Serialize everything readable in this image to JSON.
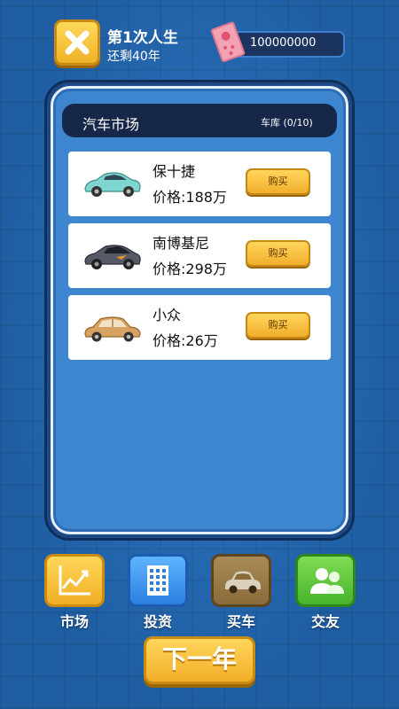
{
  "header": {
    "life_title": "第1次人生",
    "years_left": "还剩40年",
    "money": "100000000"
  },
  "market": {
    "title": "汽车市场",
    "garage": "车库 (0/10)",
    "cars": [
      {
        "name": "保十捷",
        "price": "价格:188万",
        "buy_label": "购买",
        "color": "#7fd6d1"
      },
      {
        "name": "南博基尼",
        "price": "价格:298万",
        "buy_label": "购买",
        "color": "#555a66"
      },
      {
        "name": "小众",
        "price": "价格:26万",
        "buy_label": "购买",
        "color": "#d8a262"
      }
    ]
  },
  "nav": {
    "market": "市场",
    "invest": "投资",
    "buy_car": "买车",
    "friends": "交友"
  },
  "next_year": "下一年",
  "colors": {
    "background": "#1f5ea3",
    "panel": "#3e86cf",
    "gold": "#f2ae2b"
  }
}
